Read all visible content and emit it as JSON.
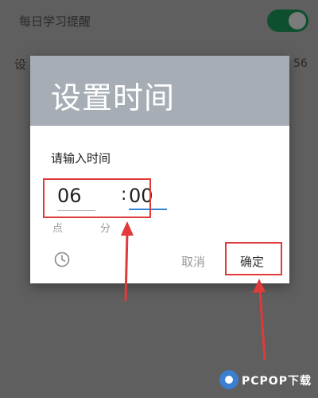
{
  "background": {
    "setting_title": "每日学习提醒",
    "setting_row2_left": "设",
    "setting_row2_right": "56",
    "toggle_state": "on"
  },
  "dialog": {
    "title": "设置时间",
    "prompt": "请输入时间",
    "hour_value": "06",
    "separator": ":",
    "minute_value": "00",
    "hour_unit": "点",
    "minute_unit": "分",
    "clock_icon": "clock-icon",
    "cancel_label": "取消",
    "ok_label": "确定"
  },
  "watermark": {
    "text": "PCPOP下载"
  },
  "colors": {
    "header": "#a6adb5",
    "accent": "#2f86d6",
    "annotation": "#e03a3a"
  }
}
